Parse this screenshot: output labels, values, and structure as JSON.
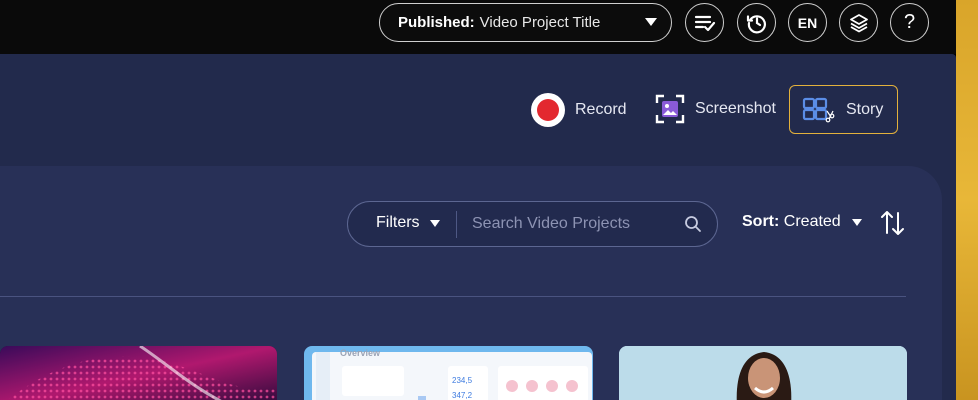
{
  "topbar": {
    "publish": {
      "prefix": "Published:",
      "value": "Video Project Title"
    },
    "language": "EN",
    "help": "?"
  },
  "toolbar": {
    "record_label": "Record",
    "screenshot_label": "Screenshot",
    "story_label": "Story"
  },
  "browser": {
    "filters_label": "Filters",
    "search_placeholder": "Search Video Projects",
    "sort_prefix": "Sort:",
    "sort_value": "Created"
  },
  "thumbnails": [
    {
      "kind": "abstract-dots"
    },
    {
      "kind": "dashboard",
      "header": "Overview",
      "metric_a": "234,5",
      "metric_b": "347,2"
    },
    {
      "kind": "portrait"
    }
  ],
  "colors": {
    "accent_gold": "#e3b13c",
    "record_red": "#e3282f",
    "panel": "#222a4c",
    "card": "#283057"
  }
}
